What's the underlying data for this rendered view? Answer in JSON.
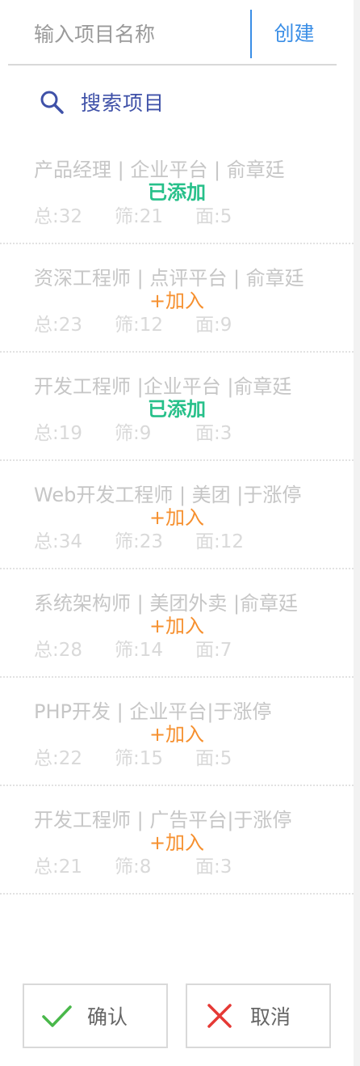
{
  "create": {
    "placeholder": "输入项目名称",
    "button_label": "创建"
  },
  "search": {
    "label": "搜索项目"
  },
  "projects": [
    {
      "title": "产品经理 | 企业平台 | 俞章廷",
      "status": "已添加",
      "total": "总:32",
      "screened": "筛:21",
      "interviewed": "面:5"
    },
    {
      "title": "资深工程师 | 点评平台 | 俞章廷",
      "status": "+加入",
      "total": "总:23",
      "screened": "筛:12",
      "interviewed": "面:9"
    },
    {
      "title": "开发工程师 |企业平台 |俞章廷",
      "status": "已添加",
      "total": "总:19",
      "screened": "筛:9",
      "interviewed": "面:3"
    },
    {
      "title": "Web开发工程师 | 美团 |于涨停",
      "status": "+加入",
      "total": "总:34",
      "screened": "筛:23",
      "interviewed": "面:12"
    },
    {
      "title": "系统架构师 | 美团外卖 |俞章廷",
      "status": "+加入",
      "total": "总:28",
      "screened": "筛:14",
      "interviewed": "面:7"
    },
    {
      "title": "PHP开发 | 企业平台|于涨停",
      "status": "+加入",
      "total": "总:22",
      "screened": "筛:15",
      "interviewed": "面:5"
    },
    {
      "title": "开发工程师 | 广告平台|于涨停",
      "status": "+加入",
      "total": "总:21",
      "screened": "筛:8",
      "interviewed": "面:3"
    }
  ],
  "footer": {
    "confirm_label": "确认",
    "cancel_label": "取消"
  },
  "colors": {
    "accent": "#3a8ee6",
    "added": "#27c08a",
    "add": "#f6902f",
    "search": "#3f51a8"
  }
}
